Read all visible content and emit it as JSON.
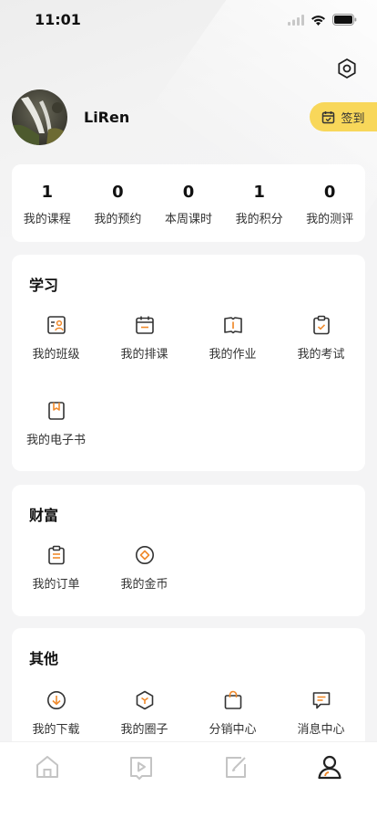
{
  "status": {
    "time": "11:01"
  },
  "profile": {
    "username": "LiRen",
    "checkin_label": "签到"
  },
  "stats": [
    {
      "value": "1",
      "label": "我的课程"
    },
    {
      "value": "0",
      "label": "我的预约"
    },
    {
      "value": "0",
      "label": "本周课时"
    },
    {
      "value": "1",
      "label": "我的积分"
    },
    {
      "value": "0",
      "label": "我的测评"
    }
  ],
  "study": {
    "title": "学习",
    "items": [
      {
        "label": "我的班级",
        "icon": "class-icon"
      },
      {
        "label": "我的排课",
        "icon": "schedule-icon"
      },
      {
        "label": "我的作业",
        "icon": "homework-icon"
      },
      {
        "label": "我的考试",
        "icon": "exam-icon"
      },
      {
        "label": "我的电子书",
        "icon": "ebook-icon"
      }
    ]
  },
  "wealth": {
    "title": "财富",
    "items": [
      {
        "label": "我的订单",
        "icon": "order-icon"
      },
      {
        "label": "我的金币",
        "icon": "coin-icon"
      }
    ]
  },
  "other": {
    "title": "其他",
    "items": [
      {
        "label": "我的下载",
        "icon": "download-icon"
      },
      {
        "label": "我的圈子",
        "icon": "circle-icon"
      },
      {
        "label": "分销中心",
        "icon": "distribution-icon"
      },
      {
        "label": "消息中心",
        "icon": "message-icon"
      }
    ]
  },
  "tabs": [
    {
      "icon": "home-icon",
      "active": false
    },
    {
      "icon": "video-icon",
      "active": false
    },
    {
      "icon": "edit-icon",
      "active": false
    },
    {
      "icon": "profile-icon",
      "active": true
    }
  ],
  "colors": {
    "accent": "#f08a2c",
    "icon_dark": "#333333",
    "checkin_bg": "#f8d75a",
    "tab_inactive": "#c4c4c4"
  }
}
